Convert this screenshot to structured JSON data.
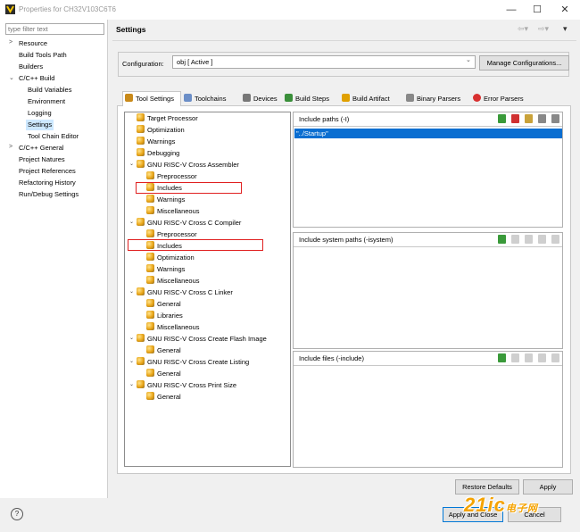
{
  "window": {
    "title": "Properties for CH32V103C6T6",
    "controls": [
      "—",
      "☐",
      "✕"
    ]
  },
  "filter": {
    "placeholder": "type filter text"
  },
  "nav": [
    {
      "label": "Resource",
      "arrow": ">"
    },
    {
      "label": "Build Tools Path"
    },
    {
      "label": "Builders"
    },
    {
      "label": "C/C++ Build",
      "arrow": "⌄"
    },
    {
      "label": "Build Variables"
    },
    {
      "label": "Environment"
    },
    {
      "label": "Logging"
    },
    {
      "label": "Settings",
      "selected": true
    },
    {
      "label": "Tool Chain Editor"
    },
    {
      "label": "C/C++ General",
      "arrow": ">"
    },
    {
      "label": "Project Natures"
    },
    {
      "label": "Project References"
    },
    {
      "label": "Refactoring History"
    },
    {
      "label": "Run/Debug Settings"
    }
  ],
  "page": {
    "title": "Settings"
  },
  "config": {
    "label": "Configuration:",
    "value": "obj  [ Active ]",
    "manage_label": "Manage Configurations..."
  },
  "tabs": [
    {
      "label": "Tool Settings",
      "icon": "tool-settings-icon"
    },
    {
      "label": "Toolchains",
      "icon": "toolchains-icon"
    },
    {
      "label": "Devices",
      "icon": "devices-icon"
    },
    {
      "label": "Build Steps",
      "icon": "build-steps-icon"
    },
    {
      "label": "Build Artifact",
      "icon": "build-artifact-icon"
    },
    {
      "label": "Binary Parsers",
      "icon": "binary-parsers-icon"
    },
    {
      "label": "Error Parsers",
      "icon": "error-parsers-icon"
    }
  ],
  "tree": [
    {
      "label": "Target Processor"
    },
    {
      "label": "Optimization"
    },
    {
      "label": "Warnings"
    },
    {
      "label": "Debugging"
    },
    {
      "label": "GNU RISC-V Cross Assembler"
    },
    {
      "label": "Preprocessor"
    },
    {
      "label": "Includes"
    },
    {
      "label": "Warnings"
    },
    {
      "label": "Miscellaneous"
    },
    {
      "label": "GNU RISC-V Cross C Compiler"
    },
    {
      "label": "Preprocessor"
    },
    {
      "label": "Includes"
    },
    {
      "label": "Optimization"
    },
    {
      "label": "Warnings"
    },
    {
      "label": "Miscellaneous"
    },
    {
      "label": "GNU RISC-V Cross C Linker"
    },
    {
      "label": "General"
    },
    {
      "label": "Libraries"
    },
    {
      "label": "Miscellaneous"
    },
    {
      "label": "GNU RISC-V Cross Create Flash Image"
    },
    {
      "label": "General"
    },
    {
      "label": "GNU RISC-V Cross Create Listing"
    },
    {
      "label": "General"
    },
    {
      "label": "GNU RISC-V Cross Print Size"
    },
    {
      "label": "General"
    }
  ],
  "panels": {
    "include_paths": {
      "title": "Include paths (-I)",
      "items": [
        "\"../Startup\""
      ]
    },
    "system_paths": {
      "title": "Include system paths (-isystem)"
    },
    "include_files": {
      "title": "Include files (-include)"
    }
  },
  "buttons": {
    "restore": "Restore Defaults",
    "apply": "Apply",
    "apply_close": "Apply and Close",
    "cancel": "Cancel",
    "help": "?"
  },
  "watermark": {
    "text": "21ic",
    "suffix": "电子网"
  }
}
